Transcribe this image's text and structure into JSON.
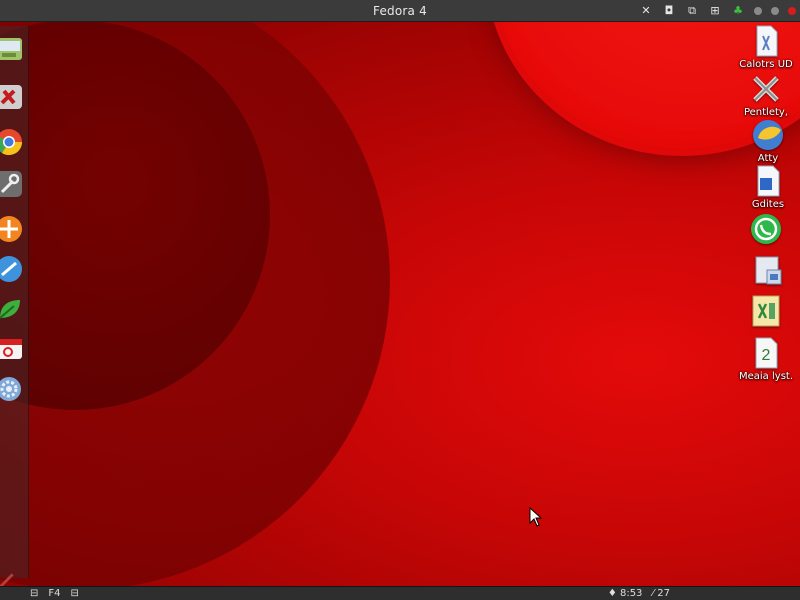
{
  "window": {
    "title": "Fedora 4"
  },
  "tray": {
    "items": [
      {
        "name": "close-x-icon",
        "glyph": "✕"
      },
      {
        "name": "camera-icon",
        "glyph": "◘"
      },
      {
        "name": "screen-icon",
        "glyph": "⧉"
      },
      {
        "name": "grid-icon",
        "glyph": "⊞"
      },
      {
        "name": "leaf-icon",
        "glyph": "♣"
      }
    ]
  },
  "desktop": {
    "icons": [
      {
        "label": "Calotrs UD",
        "icon": "document-icon"
      },
      {
        "label": "Pentlety,",
        "icon": "tools-icon"
      },
      {
        "label": "Atty",
        "icon": "paint-icon"
      },
      {
        "label": "Gdites",
        "icon": "word-doc-icon"
      },
      {
        "label": "",
        "icon": "whatsapp-icon"
      },
      {
        "label": "",
        "icon": "presentation-icon"
      },
      {
        "label": "",
        "icon": "excel-icon"
      },
      {
        "label": "Meaia lyst.",
        "icon": "number-doc-icon"
      }
    ],
    "number_doc_digit": "2"
  },
  "bottombar": {
    "left": [
      "⊟",
      "F4",
      "⊟"
    ],
    "right": [
      "♦ 8:53",
      "⁄ 27"
    ],
    "extra": ""
  },
  "colors": {
    "accent": "#d60a0a",
    "topbar": "#3b3b3b",
    "dock": "#5a2e2e"
  }
}
